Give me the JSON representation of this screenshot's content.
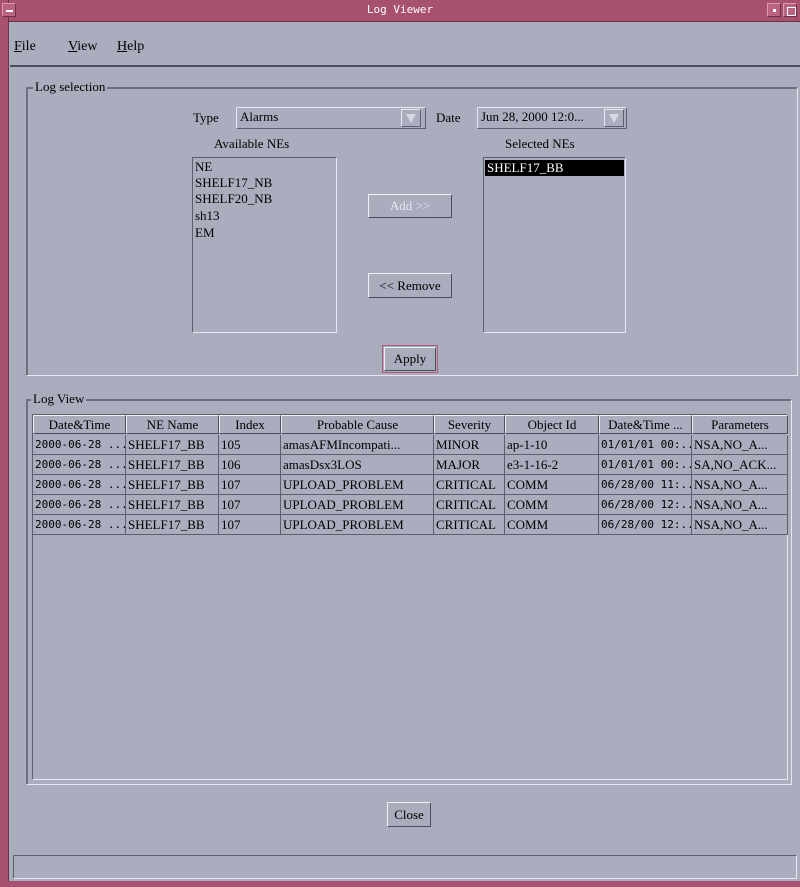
{
  "window": {
    "title": "Log Viewer"
  },
  "menu": {
    "file": {
      "mnemonic": "F",
      "rest": "ile"
    },
    "view": {
      "mnemonic": "V",
      "rest": "iew"
    },
    "help": {
      "mnemonic": "H",
      "rest": "elp"
    }
  },
  "log_selection": {
    "group_label": "Log selection",
    "type_label": "Type",
    "type_value": "Alarms",
    "date_label": "Date",
    "date_value": "Jun 28, 2000 12:0...",
    "available_label": "Available NEs",
    "selected_label": "Selected NEs",
    "available_nes": [
      "NE",
      "SHELF17_NB",
      "SHELF20_NB",
      "sh13",
      "EM"
    ],
    "selected_nes": [
      "SHELF17_BB"
    ],
    "add_label": "Add >>",
    "remove_label": "<< Remove",
    "apply_label": "Apply"
  },
  "log_view": {
    "group_label": "Log View",
    "columns": [
      "Date&Time",
      "NE Name",
      "Index",
      "Probable Cause",
      "Severity",
      "Object Id",
      "Date&Time ...",
      "Parameters"
    ],
    "rows": [
      [
        "2000-06-28 ...",
        "SHELF17_BB",
        "105",
        "amasAFMIncompati...",
        "MINOR",
        "ap-1-10",
        "01/01/01 00:...",
        "NSA,NO_A..."
      ],
      [
        "2000-06-28 ...",
        "SHELF17_BB",
        "106",
        "amasDsx3LOS",
        "MAJOR",
        "e3-1-16-2",
        "01/01/01 00:...",
        "SA,NO_ACK..."
      ],
      [
        "2000-06-28 ...",
        "SHELF17_BB",
        "107",
        "UPLOAD_PROBLEM",
        "CRITICAL",
        "COMM",
        "06/28/00 11:...",
        "NSA,NO_A..."
      ],
      [
        "2000-06-28 ...",
        "SHELF17_BB",
        "107",
        "UPLOAD_PROBLEM",
        "CRITICAL",
        "COMM",
        "06/28/00 12:...",
        "NSA,NO_A..."
      ],
      [
        "2000-06-28 ...",
        "SHELF17_BB",
        "107",
        "UPLOAD_PROBLEM",
        "CRITICAL",
        "COMM",
        "06/28/00 12:...",
        "NSA,NO_A..."
      ]
    ]
  },
  "close_label": "Close",
  "colors": {
    "background": "#a9adbd",
    "title_bar": "#a8506f"
  }
}
